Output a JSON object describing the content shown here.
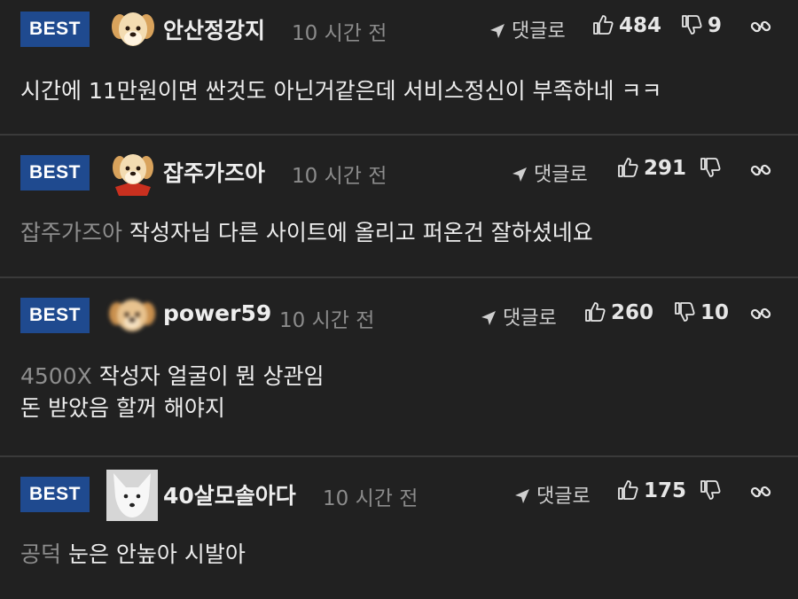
{
  "comments": [
    {
      "badge": "BEST",
      "nickname": "안산정강지",
      "time": "10 시간 전",
      "reply_label": "댓글로",
      "likes": "484",
      "dislikes": "9",
      "mention": "",
      "lines": [
        "시간에 11만원이면 싼것도 아닌거같은데 서비스정신이 부족하네 ㅋㅋ"
      ]
    },
    {
      "badge": "BEST",
      "nickname": "잡주가즈아",
      "time": "10 시간 전",
      "reply_label": "댓글로",
      "likes": "291",
      "dislikes": "",
      "mention": "잡주가즈아",
      "lines": [
        "작성자님 다른 사이트에 올리고 퍼온건 잘하셨네요"
      ]
    },
    {
      "badge": "BEST",
      "nickname": "power59",
      "time": "10 시간 전",
      "reply_label": "댓글로",
      "likes": "260",
      "dislikes": "10",
      "mention": "4500X",
      "lines": [
        "작성자 얼굴이 뭔 상관임",
        "돈 받았음 할꺼 해야지"
      ]
    },
    {
      "badge": "BEST",
      "nickname": "40살모솔아다",
      "time": "10 시간 전",
      "reply_label": "댓글로",
      "likes": "175",
      "dislikes": "",
      "mention": "공덕",
      "lines": [
        "눈은 안높아 시발아"
      ]
    }
  ],
  "colors": {
    "background": "#212121",
    "badge": "#1f4a8f",
    "divider": "#3a3a3a",
    "muted": "#8b8b8b"
  },
  "icons": [
    "puppy-avatar-icon",
    "puppy-red-cape-avatar-icon",
    "blurred-puppy-avatar-icon",
    "white-fox-avatar-icon",
    "reply-arrow-icon",
    "thumbs-up-icon",
    "thumbs-down-icon",
    "link-icon"
  ]
}
